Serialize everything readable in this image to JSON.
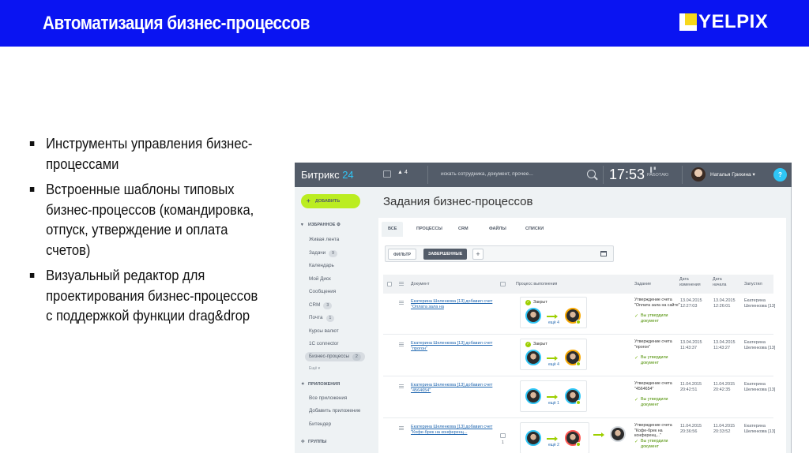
{
  "slide": {
    "title": "Автоматизация бизнес-процессов",
    "logo_text": "YELPIX",
    "bullets": [
      "Инструменты управления бизнес-процессами",
      "Встроенные шаблоны типовых бизнес-процессов (командировка, отпуск, утверждение и оплата счетов)",
      "Визуальный редактор для проектирования бизнес-процессов с поддержкой функции drag&drop"
    ]
  },
  "app": {
    "brand_name": "Битрикс",
    "brand_suffix": "24",
    "notification_count": "4",
    "search_placeholder": "искать сотрудника, документ, прочее...",
    "clock": "17:53",
    "work_state": "РАБОТАЮ",
    "user_name": "Наталья Грихина",
    "help_label": "?"
  },
  "sidebar": {
    "add_button": "ДОБАВИТЬ",
    "favorites_title": "ИЗБРАННОЕ",
    "items": [
      {
        "label": "Живая лента",
        "count": ""
      },
      {
        "label": "Задачи",
        "count": "9"
      },
      {
        "label": "Календарь",
        "count": ""
      },
      {
        "label": "Мой Диск",
        "count": ""
      },
      {
        "label": "Сообщения",
        "count": ""
      },
      {
        "label": "CRM",
        "count": "3"
      },
      {
        "label": "Почта",
        "count": "1"
      },
      {
        "label": "Курсы валют",
        "count": ""
      },
      {
        "label": "1С connector",
        "count": ""
      },
      {
        "label": "Бизнес-процессы",
        "count": "2"
      }
    ],
    "more": "Ещё ▾",
    "apps_title": "ПРИЛОЖЕНИЯ",
    "apps_items": [
      "Все приложения",
      "Добавить приложение",
      "Битендер"
    ],
    "groups_title": "ГРУППЫ"
  },
  "content": {
    "page_title": "Задания бизнес-процессов",
    "tabs": [
      "ВСЕ",
      "ПРОЦЕССЫ",
      "CRM",
      "ФАЙЛЫ",
      "СПИСКИ"
    ],
    "filter_label": "ФИЛЬТР",
    "filter_completed": "ЗАВЕРШЕННЫЕ",
    "filter_add": "+",
    "columns": {
      "document": "Документ",
      "process": "Процесс выполнения",
      "task": "Задание",
      "date_changed": "Дата изменения",
      "date_started": "Дата начала",
      "started_by": "Запустил"
    },
    "rows": [
      {
        "document": "Екатерина Шеленкова [13] добавил счет \"Оплата зала на",
        "closed": "Закрыт",
        "more": "ещё 4",
        "task": "Утверждение счета \"Оплата зала на сайте\"",
        "approve": "Вы утвердили документ",
        "date_changed": "13.04.2015 12:27:03",
        "date_started": "13.04.2015 12:26:01",
        "started_by": "Екатерина Шеленкова [13]"
      },
      {
        "document": "Екатерина Шеленкова [13] добавил счет \"прогон\"",
        "closed": "Закрыт",
        "more": "ещё 4",
        "task": "Утверждение счета \"прогон\"",
        "approve": "Вы утвердили документ",
        "date_changed": "13.04.2015 11:43:37",
        "date_started": "13.04.2015 11:43:27",
        "started_by": "Екатерина Шеленкова [13]"
      },
      {
        "document": "Екатерина Шеленкова [13] добавил счет \"4564654\"",
        "closed": "",
        "more": "ещё 1",
        "task": "Утверждение счета \"4564654\"",
        "approve": "Вы утвердили документ",
        "date_changed": "11.04.2015 20:42:51",
        "date_started": "11.04.2015 20:42:35",
        "started_by": "Екатерина Шеленкова [13]"
      },
      {
        "document": "Екатерина Шеленкова [13] добавил счет \"Кофе-брек на конференц...",
        "closed": "",
        "more": "ещё 2",
        "comment_count": "1",
        "task": "Утверждение счета \"Кофе-брек на конференц...\"",
        "approve": "Вы утвердили документ",
        "date_changed": "11.04.2015 20:36:56",
        "date_started": "11.04.2015 20:33:52",
        "started_by": "Екатерина Шеленкова [13]"
      }
    ]
  },
  "colors": {
    "header_blue": "#0a14f2",
    "logo_yellow": "#f7d81a",
    "topbar": "#535c69",
    "accent_green": "#bbed21",
    "link_blue": "#2067b0",
    "avatar_ring_blue": "#2fc6f6"
  },
  "icons": [
    "search-icon",
    "bell-icon",
    "chat-icon",
    "calendar-icon",
    "checkmark-icon",
    "comment-icon",
    "menu-icon"
  ]
}
